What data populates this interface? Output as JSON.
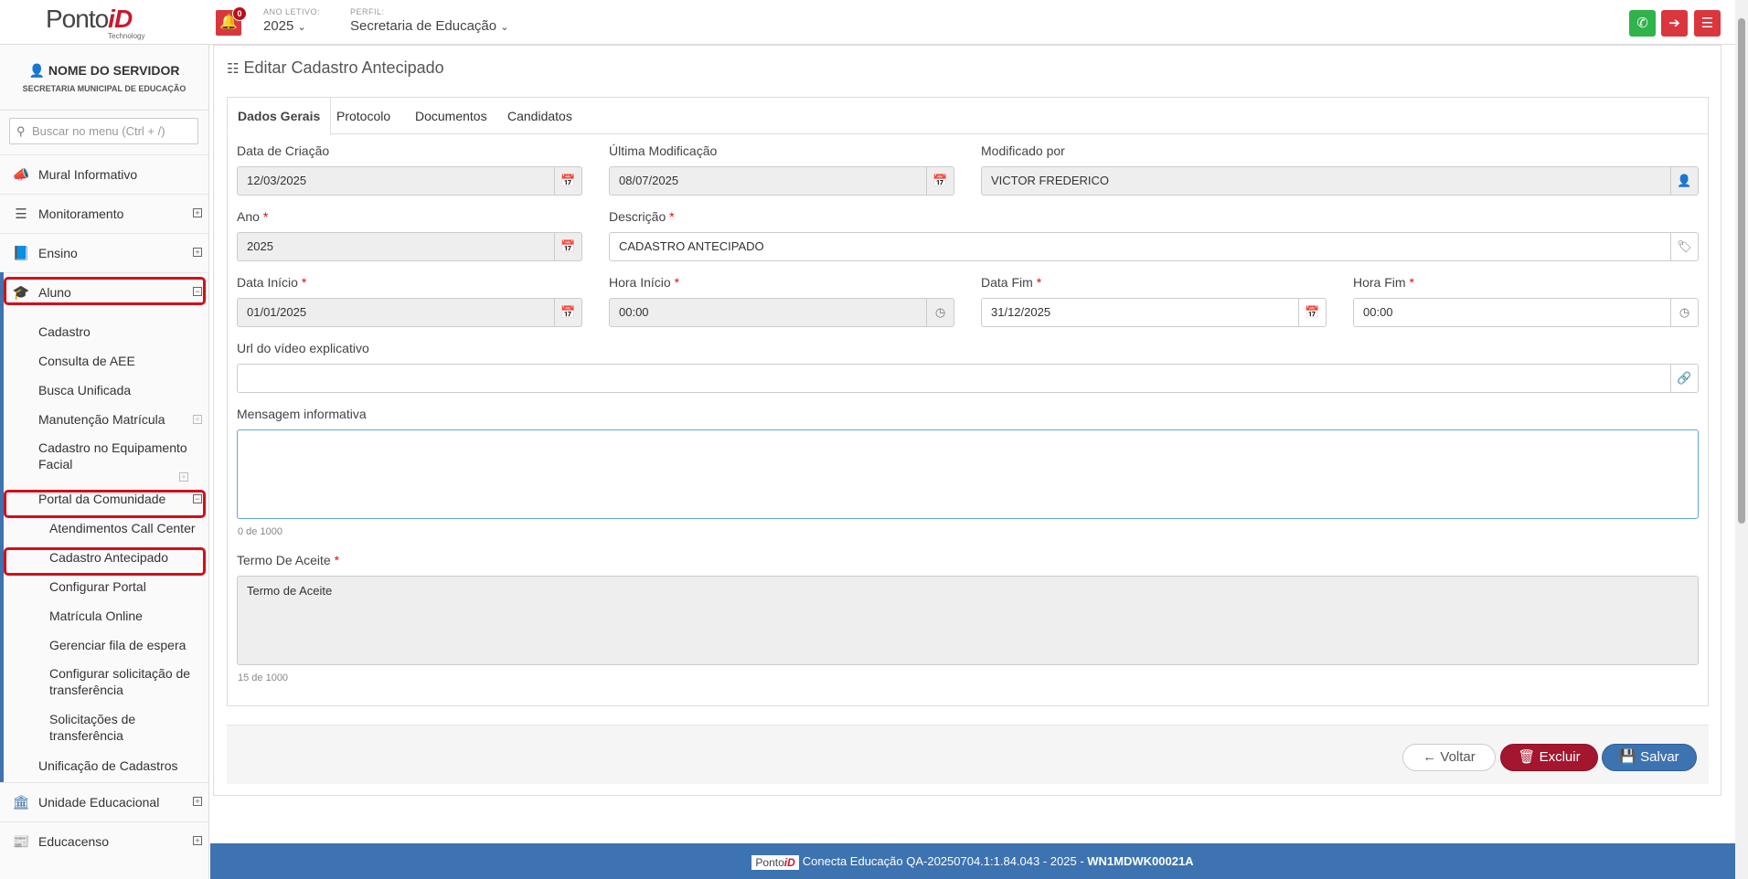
{
  "header": {
    "logo_main": "Ponto",
    "logo_accent": "iD",
    "logo_sub": "Technology",
    "notif_count": "0",
    "ano_caption": "ANO LETIVO:",
    "ano_value": "2025",
    "perfil_caption": "PERFIL:",
    "perfil_value": "Secretaria de Educação"
  },
  "sidebar": {
    "user_name": "NOME DO SERVIDOR",
    "user_org": "SECRETARIA MUNICIPAL DE EDUCAÇÃO",
    "search_placeholder": "Buscar no menu (Ctrl + /)",
    "items": [
      {
        "label": "Mural Informativo",
        "icon": "megaphone-icon"
      },
      {
        "label": "Monitoramento",
        "icon": "sliders-icon"
      },
      {
        "label": "Ensino",
        "icon": "book-icon"
      },
      {
        "label": "Aluno",
        "icon": "graduation-cap-icon"
      }
    ],
    "aluno_sub": [
      "Cadastro",
      "Consulta de AEE",
      "Busca Unificada",
      "Manutenção Matrícula",
      "Cadastro no Equipamento Facial",
      "Portal da Comunidade"
    ],
    "portal_sub": [
      "Atendimentos Call Center",
      "Cadastro Antecipado",
      "Configurar Portal",
      "Matrícula Online",
      "Gerenciar fila de espera",
      "Configurar solicitação de transferência",
      "Solicitações de transferência"
    ],
    "unificacao": "Unificação de Cadastros",
    "bottom_items": [
      {
        "label": "Unidade Educacional",
        "icon": "bank-icon"
      },
      {
        "label": "Educacenso",
        "icon": "newspaper-icon"
      }
    ]
  },
  "page": {
    "title": "Editar Cadastro Antecipado",
    "tabs": [
      "Dados Gerais",
      "Protocolo",
      "Documentos",
      "Candidatos"
    ],
    "fields": {
      "data_criacao_label": "Data de Criação",
      "data_criacao": "12/03/2025",
      "ultima_mod_label": "Última Modificação",
      "ultima_mod": "08/07/2025",
      "modificado_por_label": "Modificado por",
      "modificado_por": "VICTOR FREDERICO",
      "ano_label": "Ano",
      "ano": "2025",
      "descricao_label": "Descrição",
      "descricao": "CADASTRO ANTECIPADO",
      "data_inicio_label": "Data Início",
      "data_inicio": "01/01/2025",
      "hora_inicio_label": "Hora Início",
      "hora_inicio": "00:00",
      "data_fim_label": "Data Fim",
      "data_fim": "31/12/2025",
      "hora_fim_label": "Hora Fim",
      "hora_fim": "00:00",
      "url_label": "Url do vídeo explicativo",
      "url": "",
      "mensagem_label": "Mensagem informativa",
      "mensagem": "",
      "mensagem_count": "0 de 1000",
      "termo_label": "Termo De Aceite",
      "termo": "Termo de Aceite",
      "termo_count": "15 de 1000"
    },
    "buttons": {
      "voltar": "Voltar",
      "excluir": "Excluir",
      "salvar": "Salvar"
    }
  },
  "footer": {
    "mini_logo_main": "Ponto",
    "mini_logo_accent": "iD",
    "text": "Conecta Educação QA-20250704.1:1.84.043 - 2025 - ",
    "code": "WN1MDWK00021A"
  },
  "colors": {
    "brand_blue": "#3d73b0",
    "brand_red": "#c9182b",
    "danger": "#a3162e",
    "whatsapp": "#2fb34a"
  }
}
